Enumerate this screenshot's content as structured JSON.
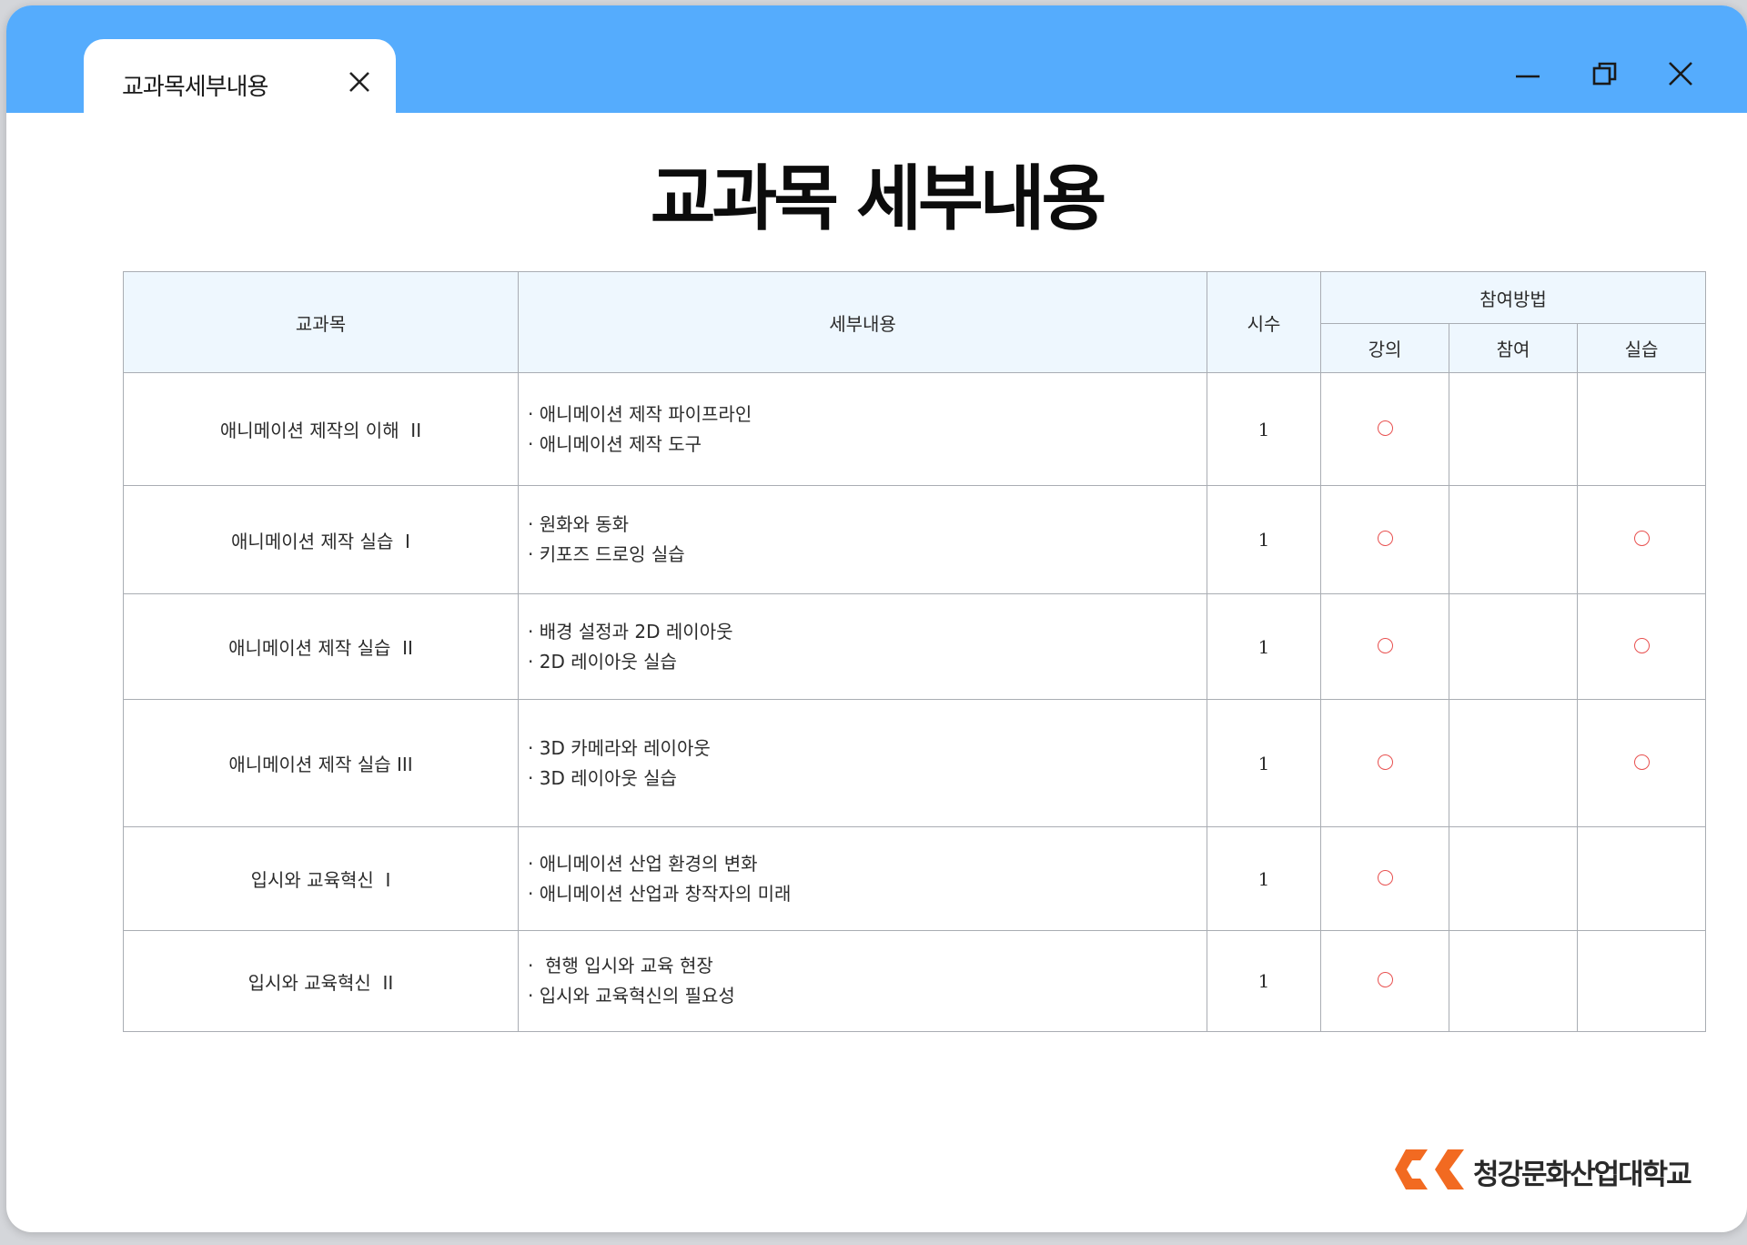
{
  "tab": {
    "label": "교과목세부내용"
  },
  "page": {
    "title": "교과목 세부내용"
  },
  "table": {
    "headers": {
      "subject": "교과목",
      "detail": "세부내용",
      "hours": "시수",
      "method": "참여방법",
      "lecture": "강의",
      "participation": "참여",
      "practice": "실습"
    },
    "rows": [
      {
        "subject": "애니메이션 제작의 이해  II",
        "details": [
          "· 애니메이션 제작 파이프라인",
          "· 애니메이션 제작 도구"
        ],
        "hours": "1",
        "lecture": true,
        "participation": false,
        "practice": false
      },
      {
        "subject": "애니메이션 제작 실습  I",
        "details": [
          "· 원화와 동화",
          "· 키포즈 드로잉 실습"
        ],
        "hours": "1",
        "lecture": true,
        "participation": false,
        "practice": true
      },
      {
        "subject": "애니메이션 제작 실습  II",
        "details": [
          "· 배경 설정과 2D 레이아웃",
          "· 2D 레이아웃 실습"
        ],
        "hours": "1",
        "lecture": true,
        "participation": false,
        "practice": true
      },
      {
        "subject": "애니메이션 제작 실습 III",
        "details": [
          "· 3D 카메라와 레이아웃",
          "· 3D 레이아웃 실습"
        ],
        "hours": "1",
        "lecture": true,
        "participation": false,
        "practice": true
      },
      {
        "subject": "입시와 교육혁신  I",
        "details": [
          "· 애니메이션 산업 환경의 변화",
          "· 애니메이션 산업과 창작자의 미래"
        ],
        "hours": "1",
        "lecture": true,
        "participation": false,
        "practice": false
      },
      {
        "subject": "입시와 교육혁신  II",
        "details": [
          "·  현행 입시와 교육 현장",
          "· 입시와 교육혁신의 필요성"
        ],
        "hours": "1",
        "lecture": true,
        "participation": false,
        "practice": false
      }
    ]
  },
  "footer": {
    "logo_text": "청강문화산업대학교"
  },
  "colors": {
    "titlebar": "#55acfd",
    "header_bg": "#eef7fe",
    "circle": "#e8504f",
    "logo_orange": "#f26a21"
  },
  "icons": {
    "tab_close": "close-icon",
    "minimize": "minimize-icon",
    "restore": "restore-icon",
    "close": "close-icon",
    "mark": "check-circle-icon"
  }
}
